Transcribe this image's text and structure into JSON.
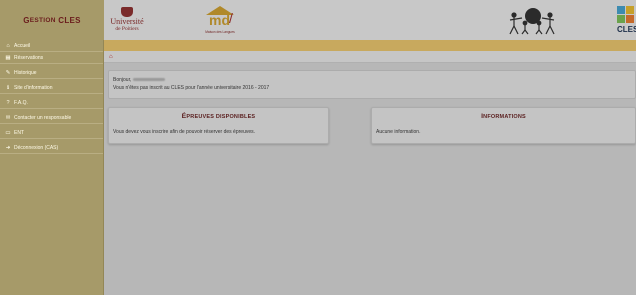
{
  "header": {
    "brand_title_initial": "G",
    "brand_title_rest": "ESTION",
    "brand_title_second": "CLES",
    "logo_univ_line1": "Université",
    "logo_univ_line2": "de Poitiers",
    "logo_md_letters": "md",
    "logo_md_caption": "Maison des Langues",
    "logo_cles_text": "CLES"
  },
  "sidebar": {
    "items": [
      {
        "icon": "home-icon",
        "glyph": "⌂",
        "label": "Accueil"
      },
      {
        "icon": "calendar-icon",
        "glyph": "▦",
        "label": "Réservations"
      },
      {
        "icon": "pencil-icon",
        "glyph": "✎",
        "label": "Historique"
      },
      {
        "icon": "info-icon",
        "glyph": "ℹ",
        "label": "Site d'information"
      },
      {
        "icon": "question-icon",
        "glyph": "?",
        "label": "F.A.Q."
      },
      {
        "icon": "envelope-icon",
        "glyph": "✉",
        "label": "Contacter un responsable"
      },
      {
        "icon": "monitor-icon",
        "glyph": "▭",
        "label": "ENT"
      },
      {
        "icon": "logout-icon",
        "glyph": "➜",
        "label": "Déconnexion (CAS)"
      }
    ]
  },
  "breadcrumb": {
    "home_glyph": "⌂"
  },
  "hello": {
    "greeting": "Bonjour,",
    "message": "Vous n'êtes pas inscrit au CLES pour l'année universitaire 2016 - 2017"
  },
  "panels": {
    "epreuves": {
      "title_initial": "É",
      "title_rest": "PREUVES DISPONIBLES",
      "body": "Vous devez vous inscrire afin de pouvoir réserver des épreuves."
    },
    "informations": {
      "title_initial": "I",
      "title_rest": "NFORMATIONS",
      "body": "Aucune information."
    }
  },
  "colors": {
    "sidebar": "#a69a69",
    "accent_bar": "#c8a95e",
    "panel_title": "#5a1f1f",
    "background": "#b7b7b7"
  }
}
